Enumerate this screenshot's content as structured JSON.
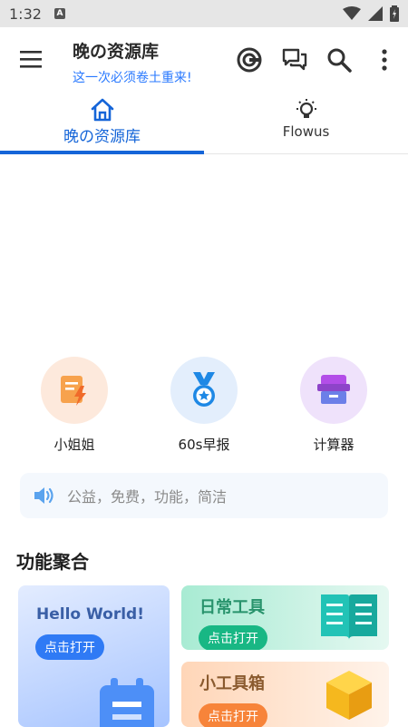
{
  "status": {
    "time": "1:32",
    "a_badge": "A"
  },
  "header": {
    "title": "晚の资源库",
    "subtitle": "这一次必须卷土重来!"
  },
  "tabs": [
    {
      "label": "晚の资源库",
      "icon": "home-icon",
      "active": true
    },
    {
      "label": "Flowus",
      "icon": "lightbulb-icon",
      "active": false
    }
  ],
  "quick": [
    {
      "label": "小姐姐",
      "icon": "note-lightning-icon",
      "bg": "#fde9dc"
    },
    {
      "label": "60s早报",
      "icon": "medal-icon",
      "bg": "#e3eefc"
    },
    {
      "label": "计算器",
      "icon": "box-icon",
      "bg": "#efe2fb"
    }
  ],
  "notice": {
    "text": "公益，免费，功能，简洁"
  },
  "section": {
    "title": "功能聚合"
  },
  "cards": {
    "hello": {
      "title": "Hello World!",
      "button": "点击打开"
    },
    "daily": {
      "title": "日常工具",
      "button": "点击打开"
    },
    "toolbox": {
      "title": "小工具箱",
      "button": "点击打开"
    }
  },
  "colors": {
    "accent": "#1565d8",
    "subtitle": "#2979ff"
  }
}
